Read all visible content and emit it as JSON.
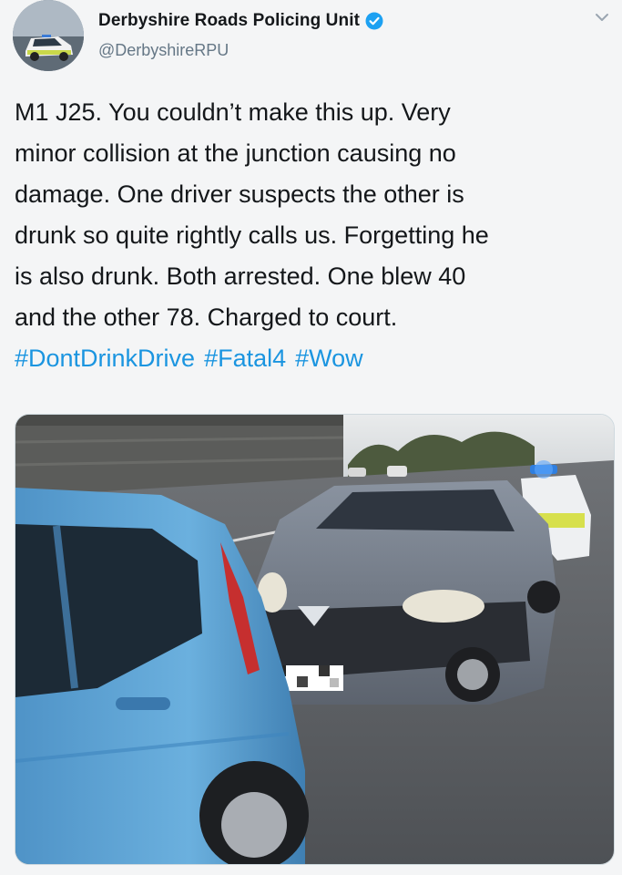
{
  "author": {
    "display_name": "Derbyshire Roads Policing Unit",
    "handle": "@DerbyshireRPU",
    "verified": true,
    "avatar_icon": "police-car-avatar",
    "verified_icon": "verified-badge-icon",
    "menu_icon": "chevron-down-icon"
  },
  "tweet": {
    "lines": [
      "M1 J25. You couldn’t make this up. Very",
      "minor collision at the junction causing no",
      "damage. One driver suspects the other is",
      "drunk so quite rightly calls us. Forgetting he",
      "is also drunk. Both arrested. One blew 40",
      "and the other 78. Charged to court."
    ],
    "hashtags": [
      "#DontDrinkDrive",
      "#Fatal4",
      "#Wow"
    ]
  },
  "media": {
    "type": "photo",
    "plate_censored": true
  },
  "colors": {
    "link": "#1b95e0",
    "verified": "#1da1f2",
    "text": "#14171a",
    "secondary": "#657786"
  }
}
